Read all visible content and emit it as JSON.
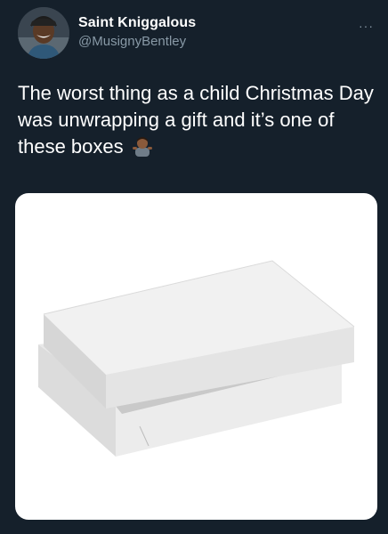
{
  "author": {
    "display_name": "Saint Kniggalous",
    "handle": "@MusignyBentley",
    "avatar_icon": "profile-photo"
  },
  "menu": {
    "more_label": "···"
  },
  "tweet": {
    "text": "The worst thing as a child Christmas Day was unwrapping a gift and it’s one of these boxes",
    "emoji": "man-shrugging-emoji"
  },
  "media": {
    "subject": "white-gift-box-image"
  },
  "colors": {
    "background": "#15202b",
    "text": "#ffffff",
    "secondary": "#8899a6",
    "media_bg": "#ffffff"
  }
}
